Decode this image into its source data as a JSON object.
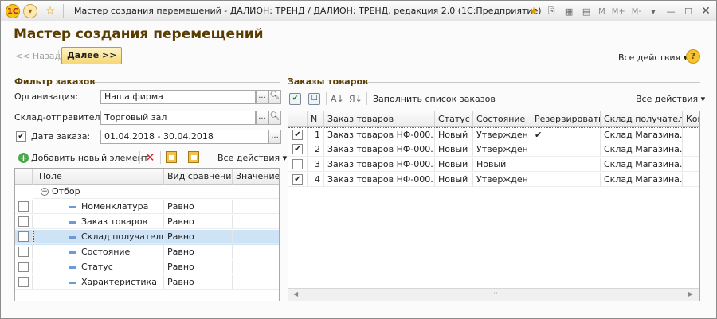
{
  "window": {
    "title": "Мастер создания перемещений - ДАЛИОН: ТРЕНД / ДАЛИОН: ТРЕНД, редакция 2.0  (1С:Предприятие)",
    "buttons": [
      "M",
      "M+",
      "M-"
    ]
  },
  "form": {
    "title": "Мастер создания перемещений",
    "back_label": "<< Назад",
    "next_label": "Далее >>",
    "all_actions": "Все действия ▾",
    "help": "?"
  },
  "filter": {
    "title": "Фильтр заказов",
    "org_label": "Организация:",
    "org_value": "Наша фирма",
    "warehouse_label": "Склад-отправитель:",
    "warehouse_value": "Торговый зал",
    "date_checked": true,
    "date_label": "Дата заказа:",
    "date_value": "01.04.2018 - 30.04.2018",
    "add_label": "Добавить новый элемент",
    "all_actions": "Все действия ▾",
    "columns": [
      "Поле",
      "Вид сравнения",
      "Значение"
    ],
    "group_label": "Отбор",
    "rows": [
      {
        "field": "Номенклатура",
        "comparison": "Равно",
        "value": ""
      },
      {
        "field": "Заказ товаров",
        "comparison": "Равно",
        "value": ""
      },
      {
        "field": "Склад получатель",
        "comparison": "Равно",
        "value": ""
      },
      {
        "field": "Состояние",
        "comparison": "Равно",
        "value": ""
      },
      {
        "field": "Статус",
        "comparison": "Равно",
        "value": ""
      },
      {
        "field": "Характеристика",
        "comparison": "Равно",
        "value": ""
      }
    ]
  },
  "orders": {
    "title": "Заказы товаров",
    "fill_label": "Заполнить список заказов",
    "all_actions": "Все действия ▾",
    "columns": [
      "N",
      "Заказ товаров",
      "Статус",
      "Состояние",
      "Резервировать",
      "Склад получатель",
      "Ком"
    ],
    "rows": [
      {
        "checked": true,
        "n": "1",
        "order": "Заказ товаров НФ-000...",
        "status": "Новый",
        "state": "Утвержден",
        "reserve": "✔",
        "warehouse": "Склад Магазина..."
      },
      {
        "checked": true,
        "n": "2",
        "order": "Заказ товаров НФ-000...",
        "status": "Новый",
        "state": "Утвержден",
        "reserve": "",
        "warehouse": "Склад Магазина..."
      },
      {
        "checked": false,
        "n": "3",
        "order": "Заказ товаров НФ-000...",
        "status": "Новый",
        "state": "Новый",
        "reserve": "",
        "warehouse": "Склад Магазина..."
      },
      {
        "checked": true,
        "n": "4",
        "order": "Заказ товаров НФ-000...",
        "status": "Новый",
        "state": "Утвержден",
        "reserve": "",
        "warehouse": "Склад Магазина..."
      }
    ]
  }
}
